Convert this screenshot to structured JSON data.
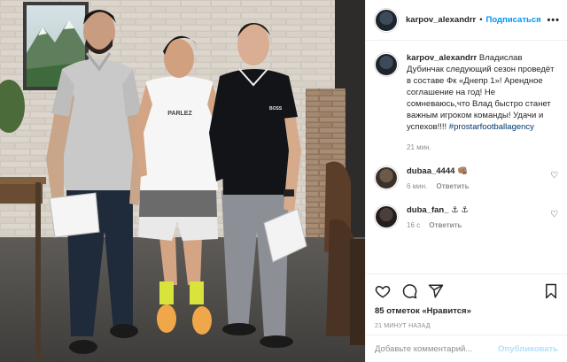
{
  "post_header": {
    "username": "karpov_alexandrr",
    "separator": "•",
    "follow_label": "Подписаться",
    "more_label": "•••"
  },
  "caption": {
    "username": "karpov_alexandrr",
    "text": "Владислав Дубинчак следующий сезон проведёт в составе Фк «Днепр 1»! Арендное соглашение на год! Не сомневаюсь,что Влад быстро станет важным игроком команды! Удачи и успехов!!!!",
    "hashtag": "#prostarfootballagency",
    "time": "21 мин."
  },
  "comments": [
    {
      "username": "dubaa_4444",
      "text": "👊🏽",
      "time": "6 мин.",
      "reply_label": "Ответить"
    },
    {
      "username": "duba_fan_",
      "text": "⚓ ⚓",
      "time": "16 с",
      "reply_label": "Ответить"
    }
  ],
  "actions": {
    "icons": [
      "heart-icon",
      "comment-icon",
      "share-icon",
      "bookmark-icon"
    ],
    "likes_text": "85 отметок «Нравится»",
    "timestamp": "21 МИНУТ НАЗАД"
  },
  "add_comment": {
    "placeholder": "Добавьте комментарий...",
    "publish_label": "Опубликовать"
  },
  "photo": {
    "shirt_text": "PARLEZ",
    "polo_text": "BOSS"
  },
  "colors": {
    "link_blue": "#0095f6",
    "publish_disabled": "#b2dffc",
    "muted": "#8e8e8e"
  }
}
